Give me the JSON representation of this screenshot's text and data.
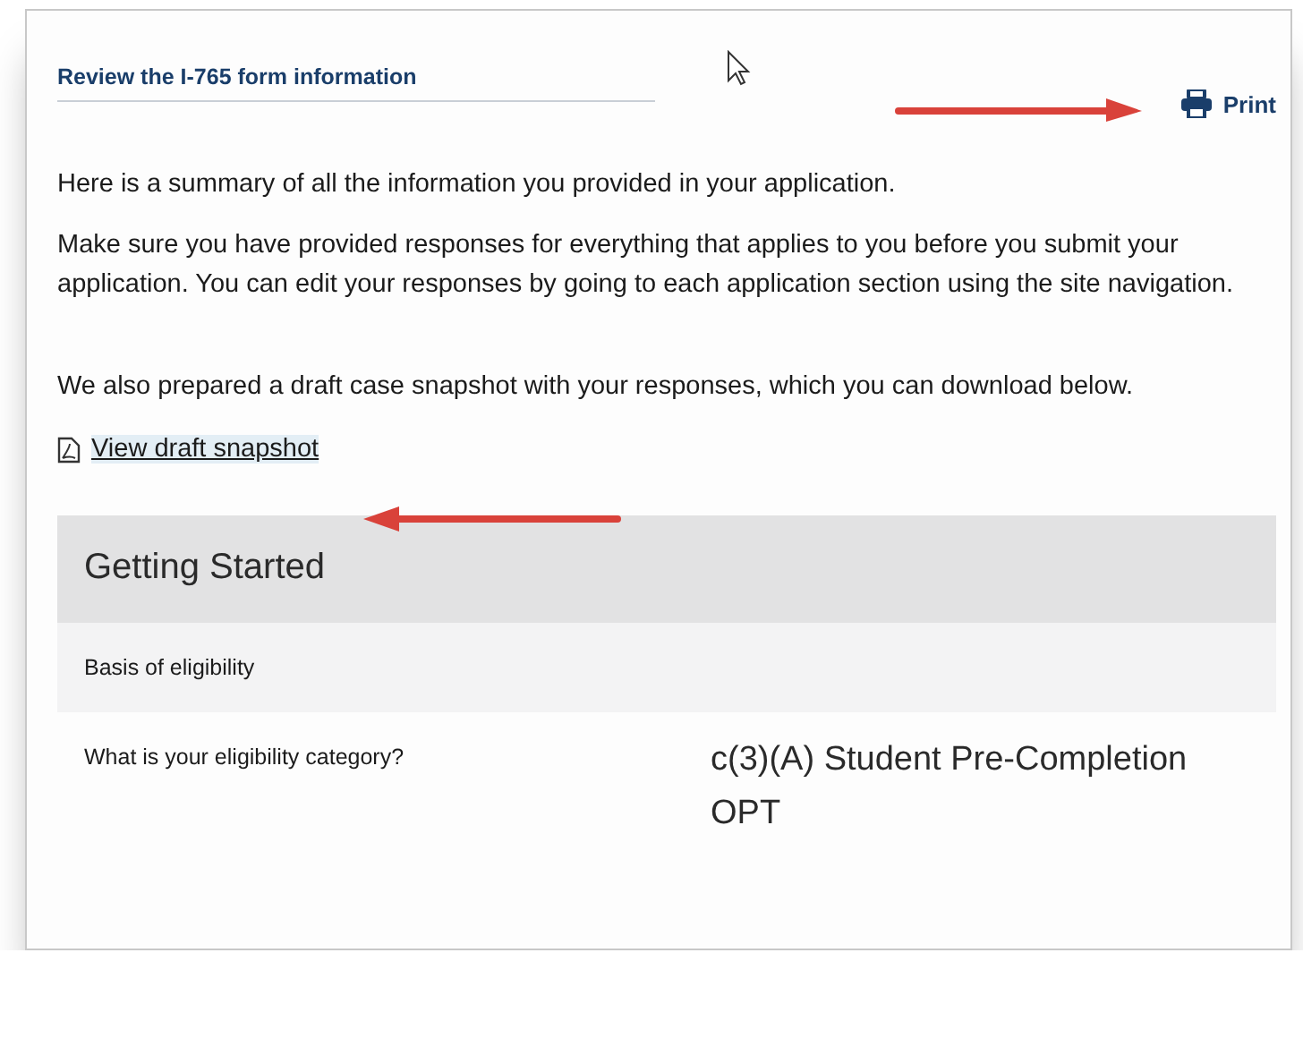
{
  "header": {
    "title": "Review the I-765 form information",
    "print": "Print"
  },
  "paragraphs": [
    "Here is a summary of all the information you provided in your application.",
    "Make sure you have provided responses for everything that applies to you before you submit your application. You can edit your responses by going to each application section using the site navigation.",
    "We also prepared a draft case snapshot with your responses, which you can download below."
  ],
  "snapshot_link": {
    "label": "View draft snapshot"
  },
  "section": {
    "title": "Getting Started",
    "subsection": "Basis of eligibility",
    "rows": [
      {
        "question": "What is your eligibility category?",
        "answer": "c(3)(A) Student Pre-Completion OPT"
      }
    ]
  }
}
